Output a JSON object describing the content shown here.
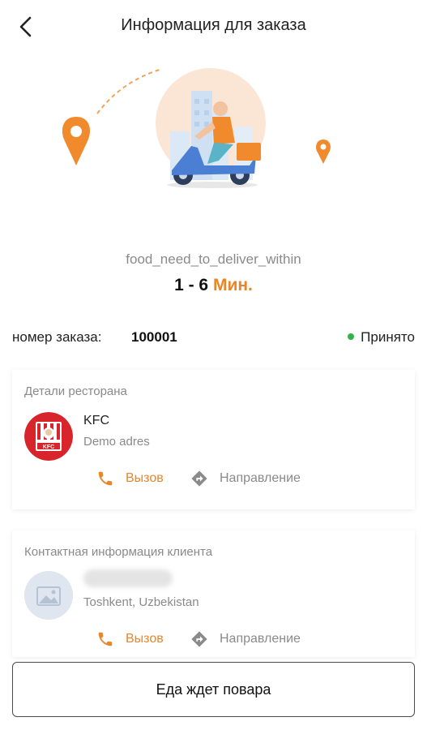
{
  "header": {
    "title": "Информация для заказа"
  },
  "delivery": {
    "label": "food_need_to_deliver_within",
    "range": "1 - 6",
    "unit": "Мин."
  },
  "order": {
    "label": "номер заказа:",
    "number": "100001",
    "status": "Принято"
  },
  "restaurant": {
    "section_title": "Детали ресторана",
    "name": "KFC",
    "address": "Demo adres",
    "logo_text": "KFC",
    "call_label": "Вызов",
    "direction_label": "Направление"
  },
  "customer": {
    "section_title": "Контактная информация клиента",
    "address": "Toshkent, Uzbekistan",
    "call_label": "Вызов",
    "direction_label": "Направление"
  },
  "footer": {
    "button_label": "Еда ждет повара"
  },
  "colors": {
    "accent": "#e8862a",
    "status_green": "#2fb34a",
    "kfc_red": "#d8252b"
  }
}
